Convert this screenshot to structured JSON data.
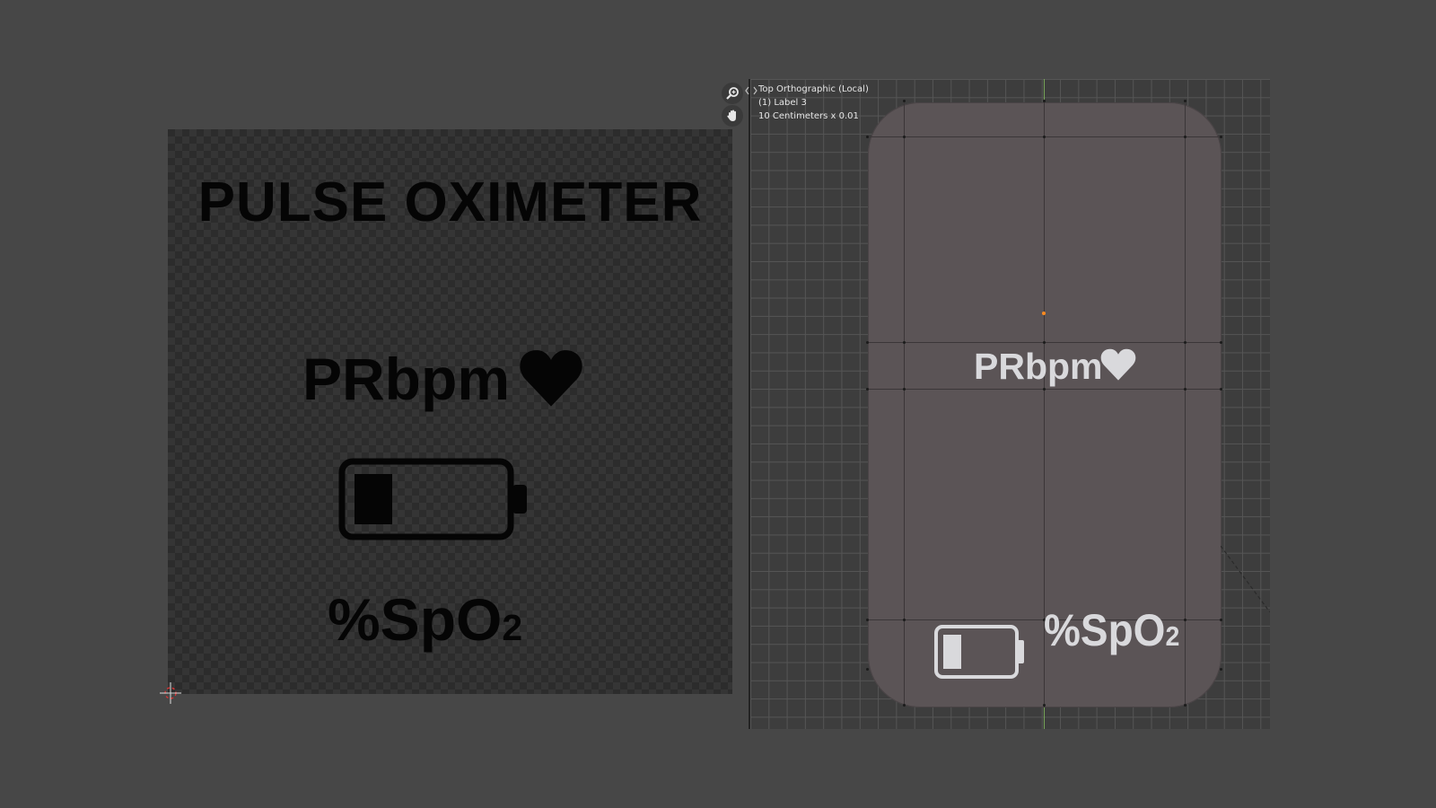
{
  "image_editor": {
    "title": "PULSE OXIMETER",
    "pr_label": "PRbpm",
    "spo2_label": "%SpO",
    "spo2_subscript": "2",
    "heart_icon": "heart-icon",
    "battery_icon": "battery-low-icon",
    "battery_level": 0.25,
    "text_color": "#050505"
  },
  "viewport": {
    "info": {
      "view_name": "Top Orthographic (Local)",
      "object_name": "(1) Label 3",
      "scale": "10 Centimeters x 0.01"
    },
    "nav": {
      "zoom_icon": "zoom-icon",
      "pan_icon": "hand-pan-icon"
    },
    "pr_label": "PRbpm",
    "spo2_label": "%SpO",
    "spo2_subscript": "2",
    "battery_level": 0.25,
    "body_color": "#5b5456",
    "label_color": "#d9d9dc",
    "axis_color": "#7fb45c",
    "origin_color": "#ff8b1f"
  }
}
